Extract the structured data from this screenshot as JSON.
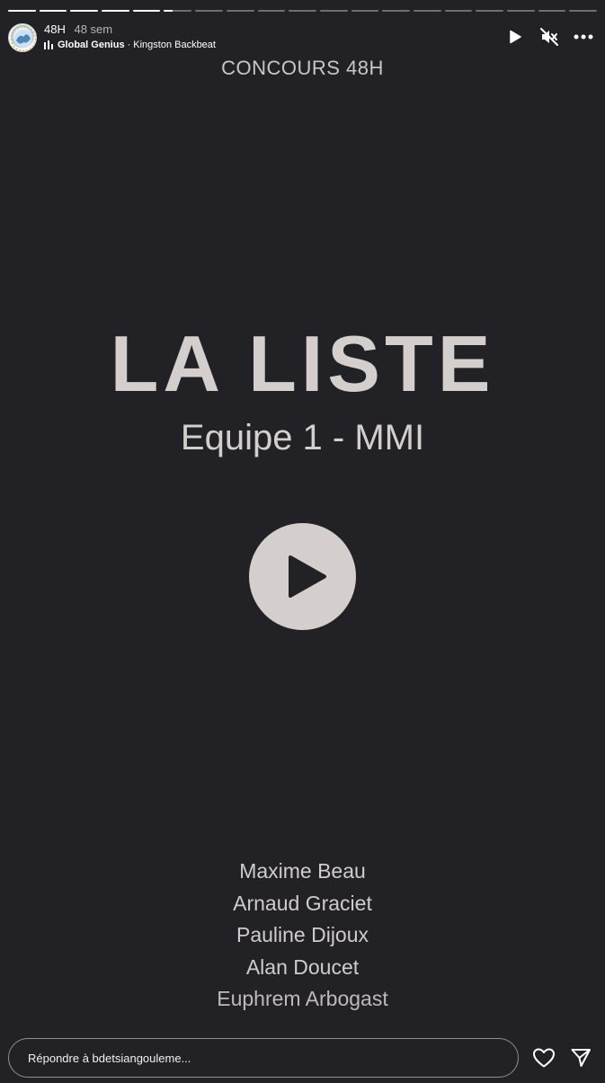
{
  "story": {
    "progress": {
      "segments": 19,
      "completed": 5,
      "current_fraction": 0.3
    },
    "header": {
      "username": "48H",
      "time": "48 sem",
      "music": {
        "artist": "Global Genius",
        "separator": "·",
        "track": "Kingston Backbeat"
      }
    },
    "icons": {
      "play": "play-icon",
      "mute": "speaker-muted-icon",
      "more": "more-options-icon",
      "like": "heart-icon",
      "share": "paper-plane-icon"
    },
    "content": {
      "top_label": "CONCOURS 48H",
      "title": "LA LISTE",
      "subtitle": "Equipe 1 - MMI",
      "names": [
        "Maxime Beau",
        "Arnaud Graciet",
        "Pauline Dijoux",
        "Alan Doucet",
        "Euphrem Arbogast"
      ]
    },
    "footer": {
      "reply_placeholder": "Répondre à bdetsiangouleme..."
    },
    "colors": {
      "background": "#222126",
      "text_light": "#d4cfcd",
      "progress_active": "#ffffff"
    }
  }
}
